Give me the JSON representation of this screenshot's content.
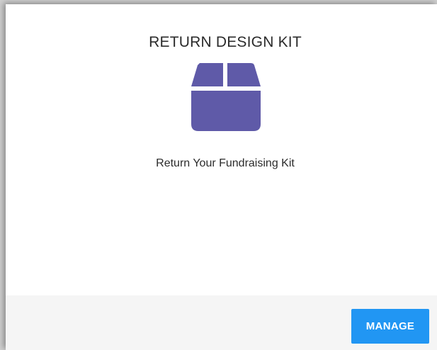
{
  "card": {
    "title": "RETURN DESIGN KIT",
    "icon": "box-icon",
    "description": "Return Your Fundraising Kit",
    "manage_label": "MANAGE"
  },
  "colors": {
    "icon": "#5f5aa8",
    "button": "#2196f3",
    "footer": "#f5f5f5"
  }
}
